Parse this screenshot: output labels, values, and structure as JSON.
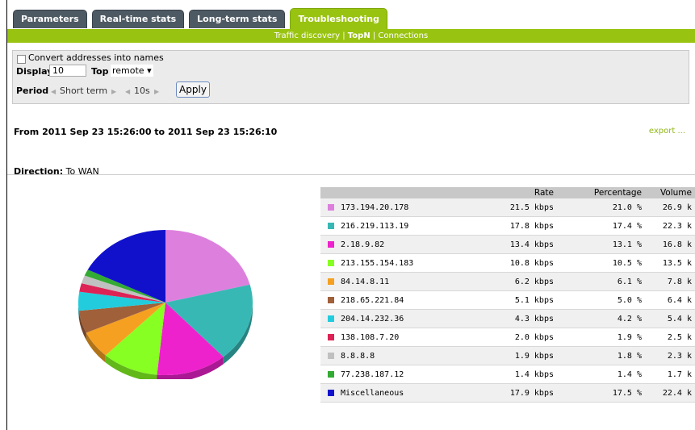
{
  "tabs": [
    {
      "label": "Parameters",
      "active": false
    },
    {
      "label": "Real-time stats",
      "active": false
    },
    {
      "label": "Long-term stats",
      "active": false
    },
    {
      "label": "Troubleshooting",
      "active": true
    }
  ],
  "subnav": {
    "items": [
      "Traffic discovery",
      "TopN",
      "Connections"
    ],
    "selected": "TopN",
    "separator": " | "
  },
  "options": {
    "convert_label": "Convert addresses into names",
    "convert_checked": false,
    "display_label": "Display",
    "display_value": "10",
    "top_label": "Top",
    "top_value": "remote ▾",
    "period_label": "Period",
    "period_value": "Short term",
    "interval_value": "10s",
    "apply_label": "Apply"
  },
  "range_text": "From 2011 Sep 23 15:26:00 to 2011 Sep 23 15:26:10",
  "export_label": "export ...",
  "direction": {
    "label": "Direction:",
    "value": " To WAN"
  },
  "table": {
    "headers": [
      "",
      "Rate",
      "Percentage",
      "Volume"
    ],
    "rows": [
      {
        "address": "173.194.20.178",
        "rate": "21.5 kbps",
        "pct": "21.0 %",
        "volume": "26.9 k",
        "color": "#dd80dd"
      },
      {
        "address": "216.219.113.19",
        "rate": "17.8 kbps",
        "pct": "17.4 %",
        "volume": "22.3 k",
        "color": "#38b8b4"
      },
      {
        "address": "2.18.9.82",
        "rate": "13.4 kbps",
        "pct": "13.1 %",
        "volume": "16.8 k",
        "color": "#ee22cc"
      },
      {
        "address": "213.155.154.183",
        "rate": "10.8 kbps",
        "pct": "10.5 %",
        "volume": "13.5 k",
        "color": "#88ff22"
      },
      {
        "address": "84.14.8.11",
        "rate": "6.2 kbps",
        "pct": "6.1 %",
        "volume": "7.8 k",
        "color": "#f5a021"
      },
      {
        "address": "218.65.221.84",
        "rate": "5.1 kbps",
        "pct": "5.0 %",
        "volume": "6.4 k",
        "color": "#a0603a"
      },
      {
        "address": "204.14.232.36",
        "rate": "4.3 kbps",
        "pct": "4.2 %",
        "volume": "5.4 k",
        "color": "#22ccdd"
      },
      {
        "address": "138.108.7.20",
        "rate": "2.0 kbps",
        "pct": "1.9 %",
        "volume": "2.5 k",
        "color": "#dd2255"
      },
      {
        "address": "8.8.8.8",
        "rate": "1.9 kbps",
        "pct": "1.8 %",
        "volume": "2.3 k",
        "color": "#c0c0c0"
      },
      {
        "address": "77.238.187.12",
        "rate": "1.4 kbps",
        "pct": "1.4 %",
        "volume": "1.7 k",
        "color": "#33aa33"
      },
      {
        "address": "Miscellaneous",
        "rate": "17.9 kbps",
        "pct": "17.5 %",
        "volume": "22.4 k",
        "color": "#1111cc"
      }
    ]
  },
  "chart_data": {
    "type": "pie",
    "categories": [
      "173.194.20.178",
      "216.219.113.19",
      "2.18.9.82",
      "213.155.154.183",
      "84.14.8.11",
      "218.65.221.84",
      "204.14.232.36",
      "138.108.7.20",
      "8.8.8.8",
      "77.238.187.12",
      "Miscellaneous"
    ],
    "values": [
      21.0,
      17.4,
      13.1,
      10.5,
      6.1,
      5.0,
      4.2,
      1.9,
      1.8,
      1.4,
      17.5
    ],
    "colors": [
      "#dd80dd",
      "#38b8b4",
      "#ee22cc",
      "#88ff22",
      "#f5a021",
      "#a0603a",
      "#22ccdd",
      "#dd2255",
      "#c0c0c0",
      "#33aa33",
      "#1111cc"
    ],
    "title": "",
    "style": "3d"
  }
}
